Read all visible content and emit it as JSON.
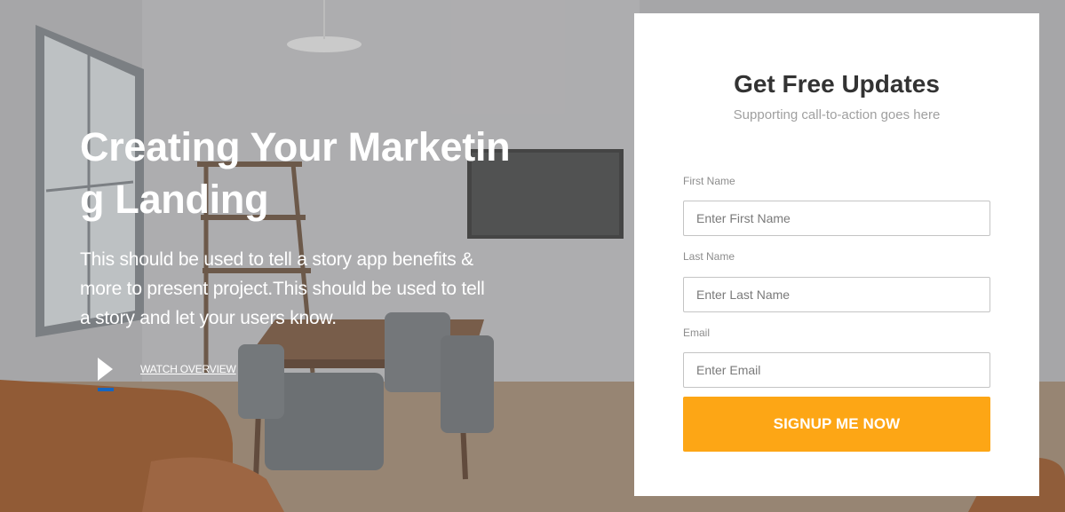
{
  "hero": {
    "title": "Creating Your Marketing Landing",
    "description": "This should be used to tell a story app benefits & more to present project.This should be used to tell a story and let your users know.",
    "watch_label": "WATCH OVERVIEW"
  },
  "signup": {
    "title": "Get Free Updates",
    "subtitle": "Supporting call-to-action goes here",
    "fields": [
      {
        "label": "First Name",
        "placeholder": "Enter First Name",
        "value": ""
      },
      {
        "label": "Last Name",
        "placeholder": "Enter Last Name",
        "value": ""
      },
      {
        "label": "Email",
        "placeholder": "Enter Email",
        "value": ""
      }
    ],
    "submit_label": "SIGNUP ME NOW"
  },
  "colors": {
    "accent": "#fda615",
    "play_underline": "#1565c0",
    "card_background": "#ffffff",
    "title_text": "#333333"
  },
  "icons": {
    "play": "play-icon"
  }
}
